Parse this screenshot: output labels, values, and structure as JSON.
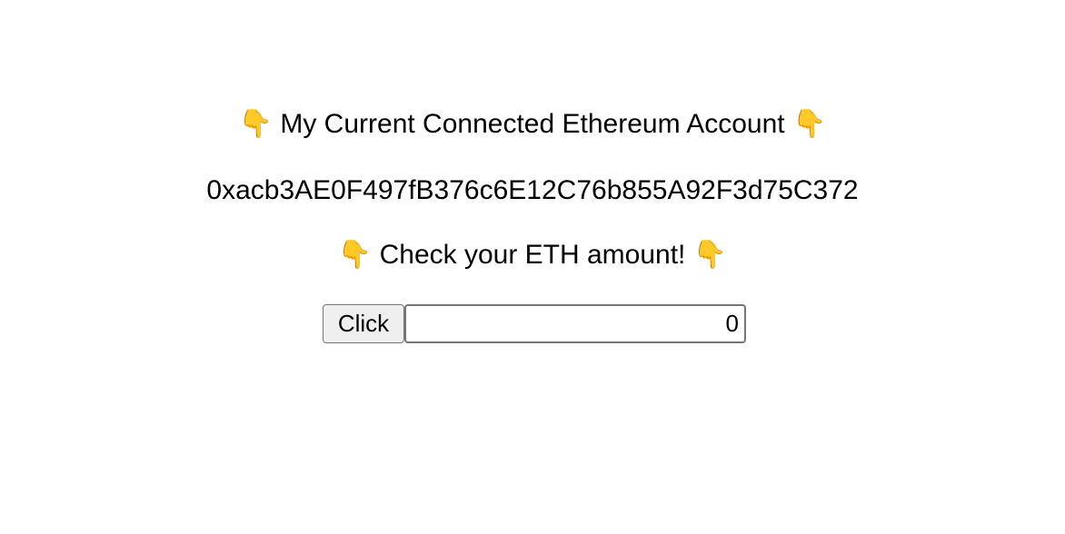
{
  "account_section": {
    "heading": "My Current Connected Ethereum Account",
    "address": "0xacb3AE0F497fB376c6E12C76b855A92F3d75C372",
    "leading_icon": "👇",
    "trailing_icon": "👇",
    "icon_name": "pointing-down-icon"
  },
  "eth_section": {
    "heading": "Check your ETH amount!",
    "leading_icon": "👇",
    "trailing_icon": "👇",
    "icon_name": "pointing-down-icon"
  },
  "controls": {
    "button_label": "Click",
    "amount_value": "0"
  },
  "colors": {
    "background": "#ffffff",
    "text": "#000000",
    "button_background": "#efefef",
    "border": "#767676"
  }
}
